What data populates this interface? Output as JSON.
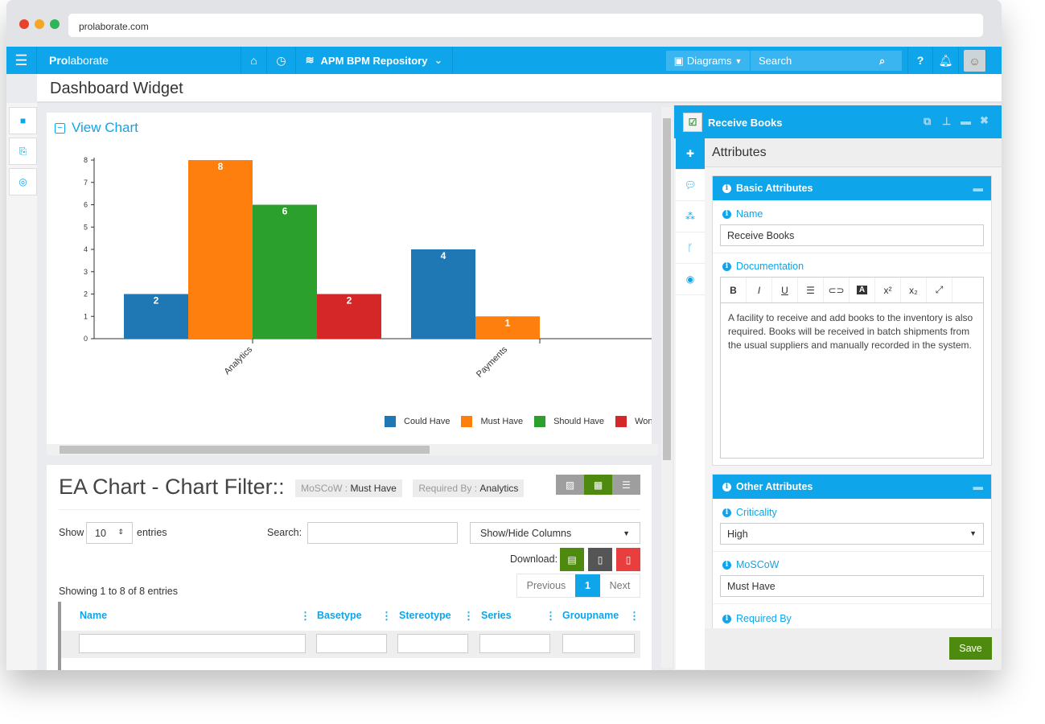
{
  "browser": {
    "url": "prolaborate.com"
  },
  "navbar": {
    "brand_bold": "Pro",
    "brand_rest": "laborate",
    "repository": "APM BPM Repository",
    "diagrams_label": "Diagrams",
    "search_placeholder": "Search",
    "accent": "#0ea5ea"
  },
  "page": {
    "title": "Dashboard Widget"
  },
  "chart_card": {
    "toggle_label": "View Chart"
  },
  "chart_data": {
    "type": "bar",
    "categories": [
      "Analytics",
      "Payments"
    ],
    "series": [
      {
        "name": "Could Have",
        "values": [
          2,
          4
        ],
        "color": "#1f77b4"
      },
      {
        "name": "Must Have",
        "values": [
          8,
          1
        ],
        "color": "#ff7f0e"
      },
      {
        "name": "Should Have",
        "values": [
          6,
          0
        ],
        "color": "#2ca02c"
      },
      {
        "name": "Won't Have",
        "values": [
          2,
          0
        ],
        "color": "#d62728"
      }
    ],
    "yticks": [
      "0",
      "1",
      "2",
      "3",
      "4",
      "5",
      "6",
      "7",
      "8"
    ],
    "ylim": [
      0,
      8
    ],
    "legend": "bottom"
  },
  "table_card": {
    "title": "EA Chart - Chart Filter::",
    "filters": [
      {
        "key": "MoSCoW : ",
        "value": "Must Have"
      },
      {
        "key": "Required By : ",
        "value": "Analytics"
      }
    ],
    "show_label": "Show",
    "entries_value": "10",
    "entries_label": "entries",
    "search_label": "Search:",
    "columns_button": "Show/Hide Columns",
    "download_label": "Download:",
    "info": "Showing 1 to 8 of 8 entries",
    "pagination": {
      "previous": "Previous",
      "current": "1",
      "next": "Next"
    },
    "columns": [
      "Name",
      "Basetype",
      "Stereotype",
      "Series",
      "Groupname"
    ]
  },
  "right_panel": {
    "title": "Receive Books",
    "section_title": "Attributes",
    "basic": {
      "title": "Basic Attributes",
      "name_label": "Name",
      "name_value": "Receive Books",
      "doc_label": "Documentation",
      "doc_text": "A facility to receive and add books to the inventory is also required. Books will be received in batch shipments from the usual suppliers and manually recorded in the system."
    },
    "other": {
      "title": "Other Attributes",
      "criticality_label": "Criticality",
      "criticality_value": "High",
      "moscow_label": "MoSCoW",
      "moscow_value": "Must Have",
      "required_by_label": "Required By"
    },
    "save_label": "Save"
  }
}
